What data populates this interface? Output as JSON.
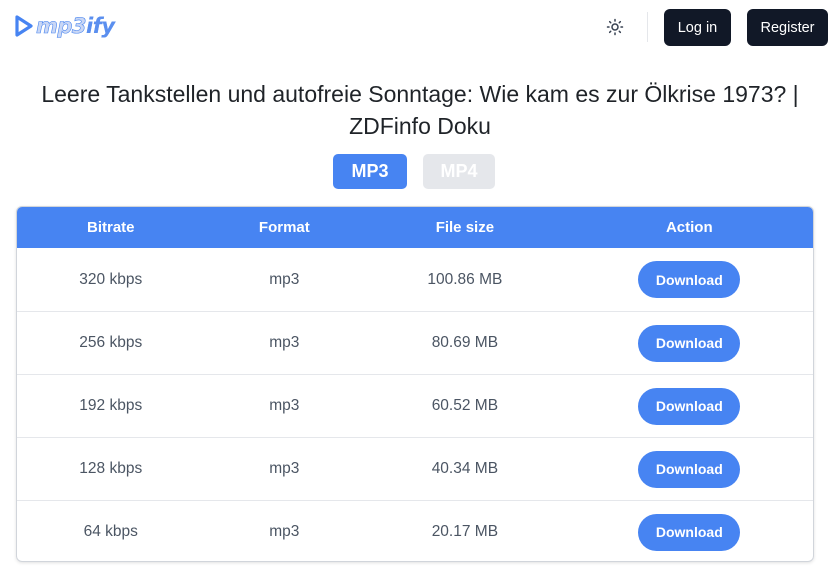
{
  "header": {
    "logo_text_main": "mp3",
    "logo_text_accent": "ify",
    "theme_icon": "sun-icon",
    "login_label": "Log in",
    "register_label": "Register"
  },
  "page": {
    "title": "Leere Tankstellen und autofreie Sonntage: Wie kam es zur Ölkrise 1973? | ZDFinfo Doku"
  },
  "format_tabs": [
    {
      "label": "MP3",
      "active": true
    },
    {
      "label": "MP4",
      "active": false
    }
  ],
  "table": {
    "headers": [
      "Bitrate",
      "Format",
      "File size",
      "Action"
    ],
    "rows": [
      {
        "bitrate": "320 kbps",
        "format": "mp3",
        "size": "100.86 MB",
        "action": "Download"
      },
      {
        "bitrate": "256 kbps",
        "format": "mp3",
        "size": "80.69 MB",
        "action": "Download"
      },
      {
        "bitrate": "192 kbps",
        "format": "mp3",
        "size": "60.52 MB",
        "action": "Download"
      },
      {
        "bitrate": "128 kbps",
        "format": "mp3",
        "size": "40.34 MB",
        "action": "Download"
      },
      {
        "bitrate": "64 kbps",
        "format": "mp3",
        "size": "20.17 MB",
        "action": "Download"
      }
    ]
  },
  "colors": {
    "accent": "#4784f2",
    "dark_button": "#111827",
    "inactive_tab": "#e5e7eb"
  }
}
